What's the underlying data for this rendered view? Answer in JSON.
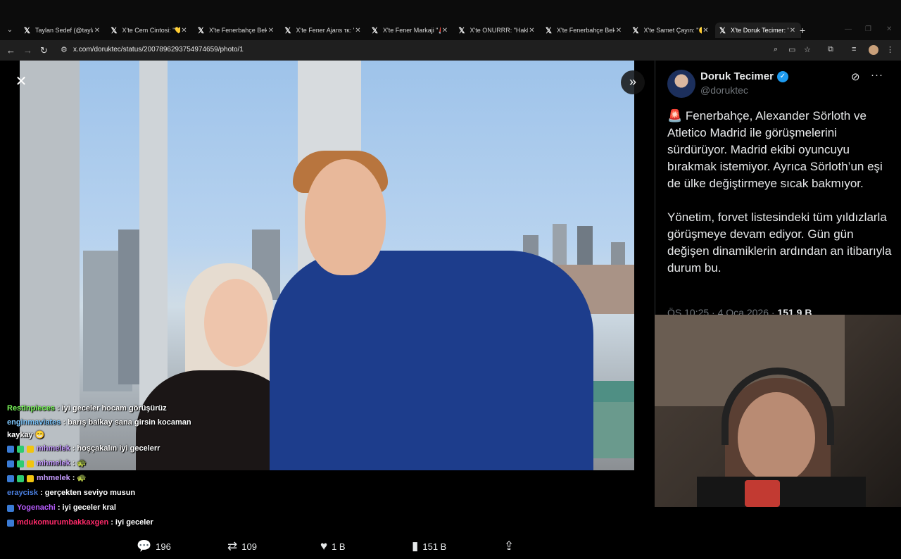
{
  "browser": {
    "tabs": [
      {
        "title": "Taylan Sedef (@taylan",
        "active": false
      },
      {
        "title": "X'te Cem Cintosi: \"💛💙",
        "active": false
      },
      {
        "title": "X'te Fenerbahçe Beko",
        "active": false
      },
      {
        "title": "X'te Fener Ajans τκ: \"",
        "active": false
      },
      {
        "title": "X'te Fener Markaji \"🚨",
        "active": false
      },
      {
        "title": "X'te ONURRR: \"Hakk",
        "active": false
      },
      {
        "title": "X'te Fenerbahçe Beko",
        "active": false
      },
      {
        "title": "X'te Samet Çayın: \"🟡",
        "active": false
      },
      {
        "title": "X'te Doruk Tecimer: \"",
        "active": true
      }
    ],
    "url": "x.com/doruktec/status/2007896293754974659/photo/1"
  },
  "chat": [
    {
      "user": "RestInpieces",
      "user_color": "#7cfc5c",
      "message": ": iyi geceler hocam görüşürüz",
      "badges": 0
    },
    {
      "user": "enginmaviates",
      "user_color": "#7ec8ff",
      "message": ": barış balkay sana girsin kocaman kaykay 😁",
      "badges": 0,
      "wrap": true
    },
    {
      "user": "mhmelek",
      "user_color": "#c69cff",
      "message": ": hoşçakalın iyi gecelerr",
      "badges": 3
    },
    {
      "user": "mhmelek",
      "user_color": "#c69cff",
      "message": ": 🐢",
      "badges": 3
    },
    {
      "user": "mhmelek",
      "user_color": "#c69cff",
      "message": ": 🐢",
      "badges": 3
    },
    {
      "user": "eraycisk",
      "user_color": "#4a7fe0",
      "message": ": gerçekten seviyo musun",
      "badges": 0
    },
    {
      "user": "Yogenachi",
      "user_color": "#b85cff",
      "message": ": iyi geceler kral",
      "badges": 1
    },
    {
      "user": "mdukomurumbakkaxgen",
      "user_color": "#ff2a6a",
      "message": ": iyi geceler",
      "badges": 1
    }
  ],
  "actions": {
    "replies": "196",
    "reposts": "109",
    "likes": "1 B",
    "views": "151 B"
  },
  "tweet": {
    "author_name": "Doruk Tecimer",
    "author_handle": "@doruktec",
    "text": "🚨 Fenerbahçe, Alexander Sörloth ve Atletico Madrid ile görüşmelerini sürdürüyor. Madrid ekibi oyuncuyu bırakmak istemiyor. Ayrıca Sörloth’un eşi de ülke değiştirmeye sıcak bakmıyor.\n\nYönetim, forvet listesindeki tüm yıldızlarla görüşmeye devam ediyor. Gün gün değişen dinamiklerin ardından an itibarıyla durum bu.",
    "meta_time": "ÖS 10:25 · 4 Oca 2026 · ",
    "meta_views": "151,9 B"
  },
  "colors": {
    "verified": "#1d9bf0",
    "text_primary": "#e7e9ea",
    "text_secondary": "#71767b"
  },
  "icons": {
    "close": "close-icon",
    "next": "chevron-double-right-icon",
    "reply": "reply-icon",
    "repost": "repost-icon",
    "like": "heart-icon",
    "views": "views-icon",
    "share": "share-icon",
    "grok": "grok-icon",
    "more": "more-icon"
  }
}
